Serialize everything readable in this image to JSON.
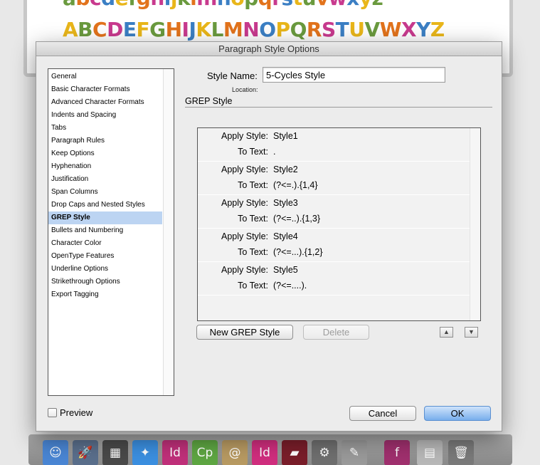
{
  "document": {
    "lowercase": [
      {
        "ch": "a",
        "color": "#6a9a3e"
      },
      {
        "ch": "b",
        "color": "#e2731c"
      },
      {
        "ch": "c",
        "color": "#c83a8e"
      },
      {
        "ch": "d",
        "color": "#3b7fc4"
      },
      {
        "ch": "e",
        "color": "#e9b61a"
      },
      {
        "ch": "f",
        "color": "#6a9a3e"
      },
      {
        "ch": "g",
        "color": "#e2731c"
      },
      {
        "ch": "h",
        "color": "#c83a8e"
      },
      {
        "ch": "i",
        "color": "#3b7fc4"
      },
      {
        "ch": "j",
        "color": "#e9b61a"
      },
      {
        "ch": "k",
        "color": "#6a9a3e"
      },
      {
        "ch": "l",
        "color": "#e2731c"
      },
      {
        "ch": "m",
        "color": "#c83a8e"
      },
      {
        "ch": "n",
        "color": "#3b7fc4"
      },
      {
        "ch": "o",
        "color": "#e9b61a"
      },
      {
        "ch": "p",
        "color": "#6a9a3e"
      },
      {
        "ch": "q",
        "color": "#e2731c"
      },
      {
        "ch": "r",
        "color": "#c83a8e"
      },
      {
        "ch": "s",
        "color": "#3b7fc4"
      },
      {
        "ch": "t",
        "color": "#e9b61a"
      },
      {
        "ch": "u",
        "color": "#6a9a3e"
      },
      {
        "ch": "v",
        "color": "#e2731c"
      },
      {
        "ch": "w",
        "color": "#c83a8e"
      },
      {
        "ch": "x",
        "color": "#3b7fc4"
      },
      {
        "ch": "y",
        "color": "#e9b61a"
      },
      {
        "ch": "z",
        "color": "#6a9a3e"
      }
    ],
    "uppercase": [
      {
        "ch": "A",
        "color": "#e9b61a"
      },
      {
        "ch": "B",
        "color": "#6a9a3e"
      },
      {
        "ch": "C",
        "color": "#e2731c"
      },
      {
        "ch": "D",
        "color": "#c83a8e"
      },
      {
        "ch": "E",
        "color": "#3b7fc4"
      },
      {
        "ch": "F",
        "color": "#e9b61a"
      },
      {
        "ch": "G",
        "color": "#6a9a3e"
      },
      {
        "ch": "H",
        "color": "#e2731c"
      },
      {
        "ch": "I",
        "color": "#c83a8e"
      },
      {
        "ch": "J",
        "color": "#3b7fc4"
      },
      {
        "ch": "K",
        "color": "#e9b61a"
      },
      {
        "ch": "L",
        "color": "#6a9a3e"
      },
      {
        "ch": "M",
        "color": "#e2731c"
      },
      {
        "ch": "N",
        "color": "#c83a8e"
      },
      {
        "ch": "O",
        "color": "#3b7fc4"
      },
      {
        "ch": "P",
        "color": "#e9b61a"
      },
      {
        "ch": "Q",
        "color": "#6a9a3e"
      },
      {
        "ch": "R",
        "color": "#e2731c"
      },
      {
        "ch": "S",
        "color": "#c83a8e"
      },
      {
        "ch": "T",
        "color": "#3b7fc4"
      },
      {
        "ch": "U",
        "color": "#e9b61a"
      },
      {
        "ch": "V",
        "color": "#6a9a3e"
      },
      {
        "ch": "W",
        "color": "#e2731c"
      },
      {
        "ch": "X",
        "color": "#c83a8e"
      },
      {
        "ch": "Y",
        "color": "#3b7fc4"
      },
      {
        "ch": "Z",
        "color": "#e9b61a"
      }
    ]
  },
  "dialog": {
    "title": "Paragraph Style Options",
    "categories": [
      {
        "label": "General",
        "selected": false
      },
      {
        "label": "Basic Character Formats",
        "selected": false
      },
      {
        "label": "Advanced Character Formats",
        "selected": false
      },
      {
        "label": "Indents and Spacing",
        "selected": false
      },
      {
        "label": "Tabs",
        "selected": false
      },
      {
        "label": "Paragraph Rules",
        "selected": false
      },
      {
        "label": "Keep Options",
        "selected": false
      },
      {
        "label": "Hyphenation",
        "selected": false
      },
      {
        "label": "Justification",
        "selected": false
      },
      {
        "label": "Span Columns",
        "selected": false
      },
      {
        "label": "Drop Caps and Nested Styles",
        "selected": false
      },
      {
        "label": "GREP Style",
        "selected": true
      },
      {
        "label": "Bullets and Numbering",
        "selected": false
      },
      {
        "label": "Character Color",
        "selected": false
      },
      {
        "label": "OpenType Features",
        "selected": false
      },
      {
        "label": "Underline Options",
        "selected": false
      },
      {
        "label": "Strikethrough Options",
        "selected": false
      },
      {
        "label": "Export Tagging",
        "selected": false
      }
    ],
    "style_name_label": "Style Name:",
    "style_name_value": "5-Cycles Style",
    "location_label": "Location:",
    "section_title": "GREP Style",
    "apply_style_label": "Apply Style:",
    "to_text_label": "To Text:",
    "grep_entries": [
      {
        "style": "Style1",
        "text": "."
      },
      {
        "style": "Style2",
        "text": "(?<=.).{1,4}"
      },
      {
        "style": "Style3",
        "text": "(?<=..).{1,3}"
      },
      {
        "style": "Style4",
        "text": "(?<=...).{1,2}"
      },
      {
        "style": "Style5",
        "text": "(?<=....)."
      }
    ],
    "new_grep_button": "New GREP Style",
    "delete_button": "Delete",
    "move_up_glyph": "▲",
    "move_down_glyph": "▼",
    "preview_label": "Preview",
    "cancel_button": "Cancel",
    "ok_button": "OK"
  },
  "dock": {
    "apps": [
      {
        "name": "finder-icon",
        "glyph": "☺",
        "color": "#4a86d4"
      },
      {
        "name": "launchpad-icon",
        "glyph": "🚀",
        "color": "#5a6f8c"
      },
      {
        "name": "mission-control-icon",
        "glyph": "▦",
        "color": "#4a4a4a"
      },
      {
        "name": "safari-icon",
        "glyph": "✦",
        "color": "#3b8fe0"
      },
      {
        "name": "indesign-dark-icon",
        "glyph": "Id",
        "color": "#c0307a"
      },
      {
        "name": "captivate-icon",
        "glyph": "Cp",
        "color": "#5ea642"
      },
      {
        "name": "address-book-icon",
        "glyph": "@",
        "color": "#b89a62"
      },
      {
        "name": "indesign-icon",
        "glyph": "Id",
        "color": "#d02e7e"
      },
      {
        "name": "book-icon",
        "glyph": "▰",
        "color": "#7a1e2a"
      },
      {
        "name": "system-preferences-icon",
        "glyph": "⚙",
        "color": "#6f6f6f"
      },
      {
        "name": "script-editor-icon",
        "glyph": "✎",
        "color": "#9a9a9a"
      },
      {
        "name": "font-book-icon",
        "glyph": "f",
        "color": "#a0306e"
      },
      {
        "name": "preview-icon",
        "glyph": "▤",
        "color": "#b8b8b8"
      },
      {
        "name": "trash-icon",
        "glyph": "🗑",
        "color": "#7a7a7a"
      }
    ]
  }
}
